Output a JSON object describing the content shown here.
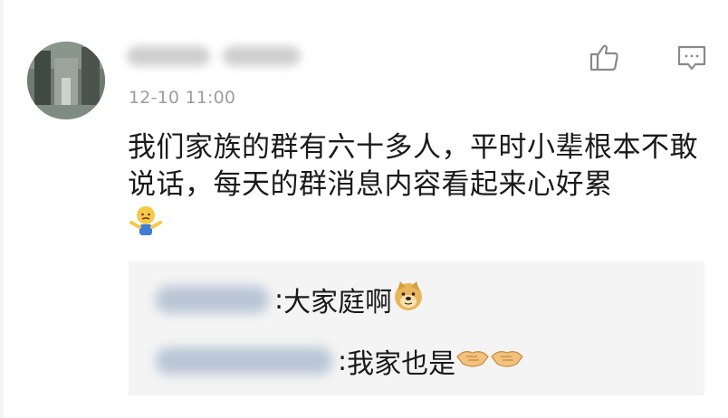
{
  "comment": {
    "author_avatar_icon": "avatar-photo",
    "author_name_blurred": true,
    "timestamp": "12-10 11:00",
    "text": "我们家族的群有六十多人，平时小辈根本不敢说话，每天的群消息内容看起来心好累",
    "trailing_emoji": "shrug-emoji",
    "actions": {
      "like_icon": "thumbs-up-icon",
      "reply_icon": "comment-bubble-icon"
    }
  },
  "replies": [
    {
      "author_name_blurred": true,
      "separator": ":",
      "text": " 大家庭啊",
      "trailing_emoji": "doge-emoji"
    },
    {
      "author_name_blurred": true,
      "separator": ":",
      "text": " 我家也是",
      "trailing_emoji": "handshake-emoji"
    }
  ],
  "colors": {
    "text": "#1a1a1a",
    "meta": "#9e9e9e",
    "reply_bg": "#f4f4f4",
    "icon": "#8a8a8a"
  }
}
